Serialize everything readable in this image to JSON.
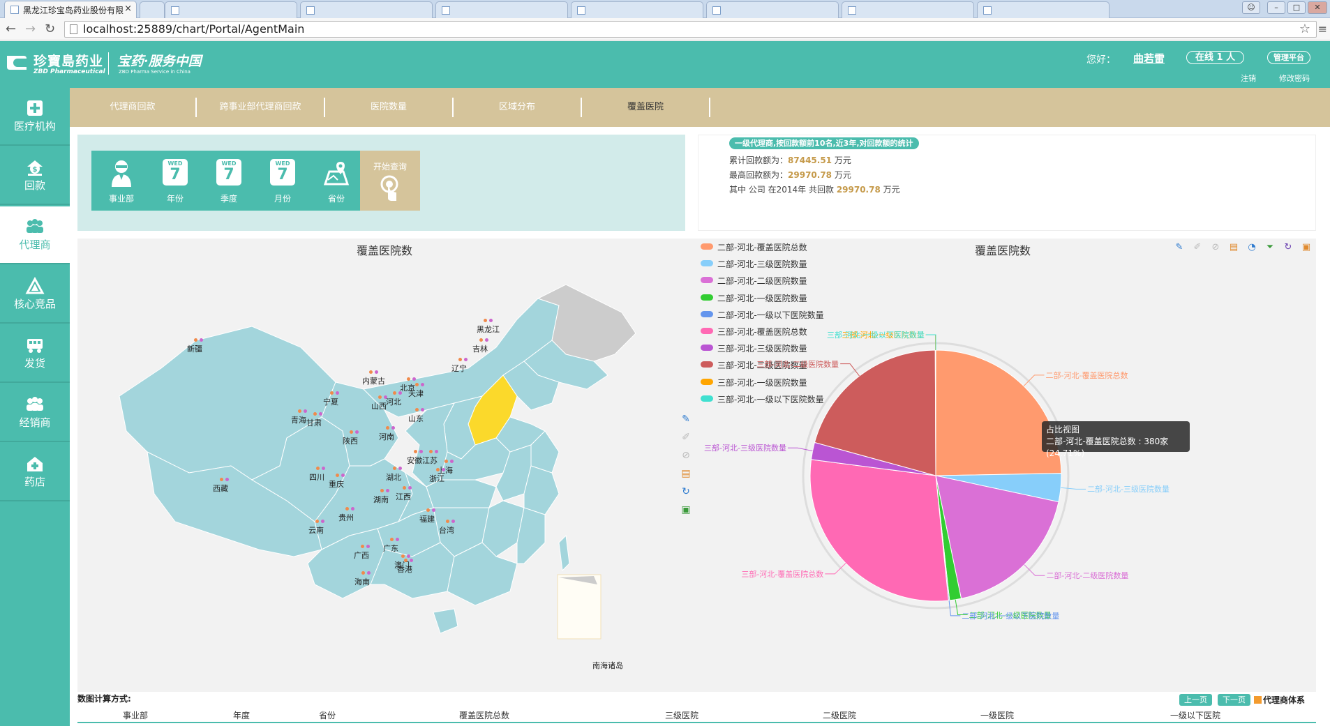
{
  "browser": {
    "tabs": [
      {
        "title": "黑龙江珍宝岛药业股份有限",
        "active": true
      },
      {
        "title": "",
        "active": false
      },
      {
        "title": "",
        "active": false
      },
      {
        "title": "",
        "active": false
      },
      {
        "title": "",
        "active": false
      },
      {
        "title": "",
        "active": false
      },
      {
        "title": "",
        "active": false
      },
      {
        "title": "",
        "active": false
      }
    ],
    "url": "localhost:25889/chart/Portal/AgentMain"
  },
  "header": {
    "logo_cn": "珍寶島药业",
    "logo_en": "ZBD Pharmaceutical",
    "slogan": "宝药·服务中国",
    "slogan_en": "ZBD Pharma Service in China",
    "greeting": "您好：",
    "username": "曲若雷",
    "online": "在线 1 人",
    "admin": "管理平台",
    "logout": "注销",
    "change_password": "修改密码"
  },
  "sidebar": {
    "items": [
      {
        "label": "医疗机构",
        "icon": "medical-cross-icon",
        "active": false
      },
      {
        "label": "回款",
        "icon": "money-icon",
        "active": false
      },
      {
        "label": "代理商",
        "icon": "agents-icon",
        "active": true
      },
      {
        "label": "核心竞品",
        "icon": "triangle-icon",
        "active": false
      },
      {
        "label": "发货",
        "icon": "truck-icon",
        "active": false
      },
      {
        "label": "经销商",
        "icon": "dealers-icon",
        "active": false
      },
      {
        "label": "药店",
        "icon": "pharmacy-icon",
        "active": false
      }
    ]
  },
  "tabs": [
    {
      "label": "代理商回款",
      "active": false
    },
    {
      "label": "跨事业部代理商回款",
      "active": false
    },
    {
      "label": "医院数量",
      "active": false
    },
    {
      "label": "区域分布",
      "active": false
    },
    {
      "label": "覆盖医院",
      "active": true
    }
  ],
  "filters": {
    "buttons": [
      {
        "label": "事业部",
        "icon": "person-icon"
      },
      {
        "label": "年份",
        "icon": "calendar-icon",
        "weekday": "WED",
        "day": "7"
      },
      {
        "label": "季度",
        "icon": "calendar-icon",
        "weekday": "WED",
        "day": "7"
      },
      {
        "label": "月份",
        "icon": "calendar-icon",
        "weekday": "WED",
        "day": "7"
      },
      {
        "label": "省份",
        "icon": "map-pin-icon"
      }
    ],
    "query_label": "开始查询"
  },
  "stats": {
    "title": "一级代理商,按回款额前10名,近3年,对回款额的统计",
    "line1_prefix": "累计回款额为：",
    "line1_value": "87445.51",
    "line1_unit": "万元",
    "line2_prefix": "最高回款额为：",
    "line2_value": "29970.78",
    "line2_unit": "万元",
    "line3_prefix": "其中 公司 在2014年 共回款",
    "line3_value": "29970.78",
    "line3_unit": "万元"
  },
  "colors": {
    "primary": "#4bbcad",
    "tan": "#d5c49b",
    "map_fill": "#a3d5dc",
    "map_selected": "#fbd92b",
    "map_gray": "#cccccc"
  },
  "map": {
    "title": "覆盖医院数",
    "inset_label": "南海诸岛",
    "provinces": [
      "新疆",
      "西藏",
      "青海",
      "甘肃",
      "宁夏",
      "内蒙古",
      "黑龙江",
      "吉林",
      "辽宁",
      "北京",
      "天津",
      "河北",
      "山西",
      "山东",
      "陕西",
      "河南",
      "四川",
      "重庆",
      "湖北",
      "安徽",
      "江苏",
      "上海",
      "浙江",
      "湖南",
      "江西",
      "贵州",
      "云南",
      "广西",
      "广东",
      "福建",
      "台湾",
      "香港",
      "澳门",
      "海南"
    ],
    "selected": [
      "北京",
      "天津",
      "河北"
    ],
    "tools": [
      "pen-icon",
      "eraser-icon",
      "clear-icon",
      "data-view-icon",
      "refresh-icon",
      "save-icon"
    ]
  },
  "chart_data": {
    "type": "pie",
    "title": "覆盖医院数",
    "legend_position": "top-left",
    "slices": [
      {
        "name": "二部-河北-覆盖医院总数",
        "value": 380,
        "color": "#ff9a6e"
      },
      {
        "name": "二部-河北-三级医院数量",
        "value": 56,
        "color": "#87cefa"
      },
      {
        "name": "二部-河北-二级医院数量",
        "value": 283,
        "color": "#da70d6"
      },
      {
        "name": "二部-河北-一级医院数量",
        "value": 23,
        "color": "#32cd32"
      },
      {
        "name": "二部-河北-一级以下医院数量",
        "value": 2,
        "color": "#6495ed"
      },
      {
        "name": "三部-河北-覆盖医院总数",
        "value": 441,
        "color": "#ff69b4"
      },
      {
        "name": "三部-河北-三级医院数量",
        "value": 34,
        "color": "#ba55d3"
      },
      {
        "name": "三部-河北-二级医院数量",
        "value": 318,
        "color": "#cd5c5c"
      },
      {
        "name": "三部-河北-一级医院数量",
        "value": 1,
        "color": "#ffa500"
      },
      {
        "name": "三部-河北-一级以下医院数量",
        "value": 0,
        "color": "#40e0d0"
      }
    ],
    "tooltip": {
      "title": "占比视图",
      "text": "二部-河北-覆盖医院总数 : 380家(24.71%)"
    },
    "tools": [
      "pen-icon",
      "eraser-icon",
      "clear-icon",
      "data-view-icon",
      "pie-type-icon",
      "funnel-icon",
      "refresh-icon",
      "save-icon"
    ]
  },
  "table": {
    "calc_label": "数图计算方式:",
    "prev": "上一页",
    "next": "下一页",
    "agent_system": "代理商体系",
    "columns": [
      "事业部",
      "年度",
      "省份",
      "覆盖医院总数",
      "三级医院",
      "二级医院",
      "一级医院",
      "一级以下医院"
    ]
  }
}
